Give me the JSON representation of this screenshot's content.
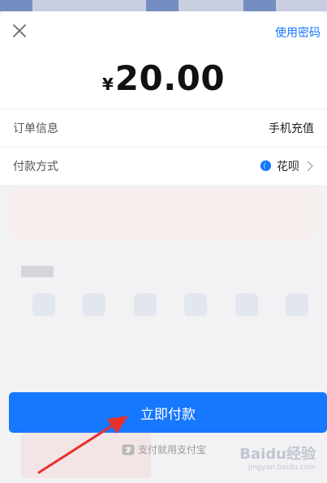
{
  "sheet": {
    "use_password_label": "使用密码",
    "currency_symbol": "¥",
    "amount": "20.00"
  },
  "order": {
    "label": "订单信息",
    "value": "手机充值"
  },
  "payment": {
    "label": "付款方式",
    "method": "花呗"
  },
  "pay_button_label": "立即付款",
  "slogan": "支付就用支付宝",
  "watermark": {
    "brand": "Baidu经验",
    "url": "jingyan.baidu.com"
  },
  "colors": {
    "accent": "#1677ff",
    "annotation_arrow": "#e8302b"
  }
}
